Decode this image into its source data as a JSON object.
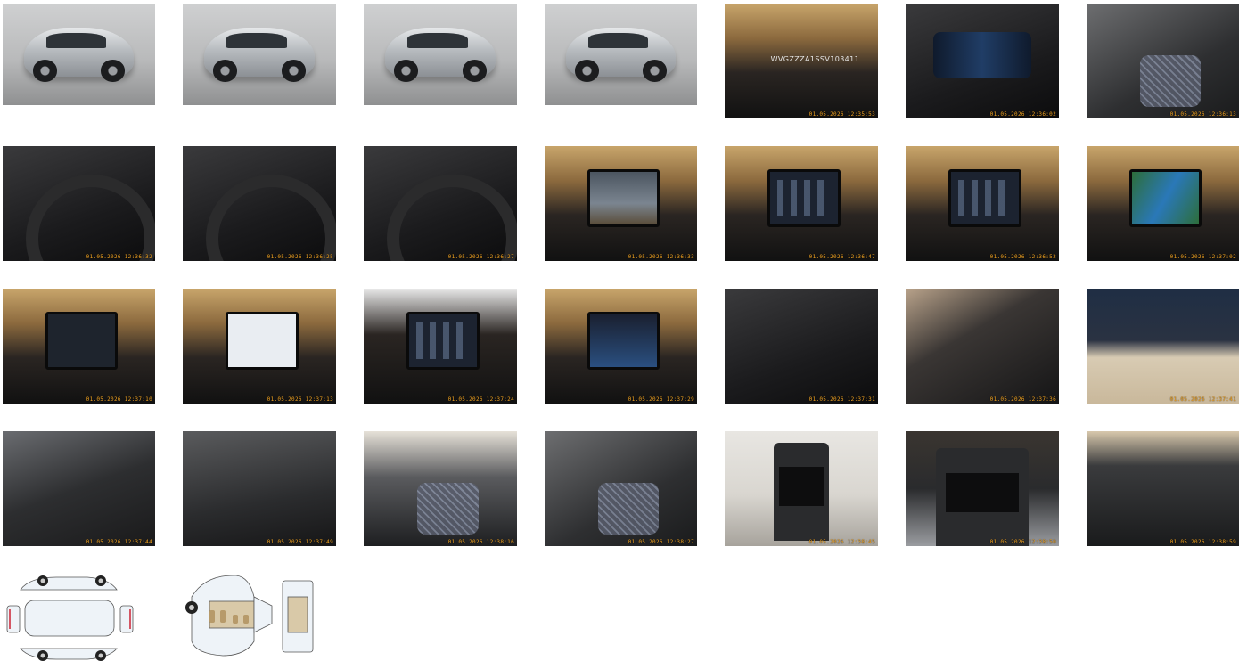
{
  "gallery": {
    "vin_text": "WVGZZZA1SSV103411",
    "timestamps": [
      "01.05.2026 12:35:53",
      "01.05.2026 12:36:02",
      "01.05.2026 12:36:13",
      "01.05.2026 12:36:32",
      "01.05.2026 12:36:25",
      "01.05.2026 12:36:27",
      "01.05.2026 12:36:33",
      "01.05.2026 12:36:47",
      "01.05.2026 12:36:52",
      "01.05.2026 12:37:02",
      "01.05.2026 12:37:10",
      "01.05.2026 12:37:13",
      "01.05.2026 12:37:24",
      "01.05.2026 12:37:29",
      "01.05.2026 12:37:31",
      "01.05.2026 12:37:36",
      "01.05.2026 12:37:41",
      "01.05.2026 12:37:44",
      "01.05.2026 12:37:49",
      "01.05.2026 12:38:16",
      "01.05.2026 12:38:27",
      "01.05.2026 12:38:45",
      "01.05.2026 12:38:50",
      "01.05.2026 12:38:59"
    ],
    "colors": {
      "timestamp": "#f5a623",
      "background": "#ffffff"
    }
  }
}
